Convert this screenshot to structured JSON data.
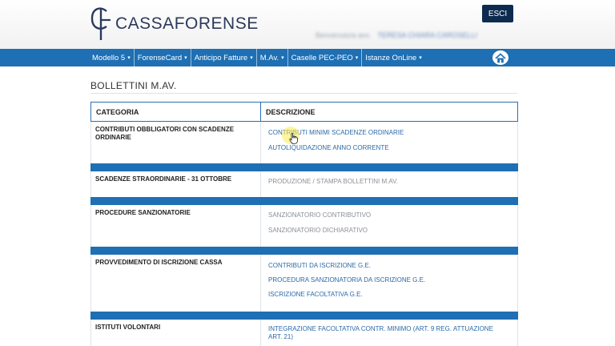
{
  "header": {
    "logo_text": "CASSAFORENSE",
    "exit_label": "ESCI",
    "user_label": "Benvenuto/a avv.",
    "user_name": "TERESA CHIARA CAROSELLI"
  },
  "nav": {
    "items": [
      {
        "label": "Modello 5"
      },
      {
        "label": "ForenseCard"
      },
      {
        "label": "Anticipo Fatture"
      },
      {
        "label": "M.Av."
      },
      {
        "label": "Caselle PEC-PEO"
      },
      {
        "label": "Istanze OnLine"
      }
    ],
    "caret": "▾"
  },
  "page": {
    "title": "BOLLETTINI M.AV."
  },
  "table": {
    "headers": {
      "category": "CATEGORIA",
      "description": "DESCRIZIONE"
    },
    "rows": [
      {
        "category": "CONTRIBUTI OBBLIGATORI CON SCADENZE ORDINARIE",
        "links": [
          {
            "label": "CONTRIBUTI MINIMI SCADENZE ORDINARIE",
            "enabled": true
          },
          {
            "label": "AUTOLIQUIDAZIONE ANNO CORRENTE",
            "enabled": true
          }
        ]
      },
      {
        "category": "SCADENZE STRAORDINARIE - 31 OTTOBRE",
        "links": [
          {
            "label": "PRODUZIONE / STAMPA BOLLETTINI M.AV.",
            "enabled": false
          }
        ]
      },
      {
        "category": "PROCEDURE SANZIONATORIE",
        "links": [
          {
            "label": "SANZIONATORIO CONTRIBUTIVO",
            "enabled": false
          },
          {
            "label": "SANZIONATORIO DICHIARATIVO",
            "enabled": false
          }
        ]
      },
      {
        "category": "PROVVEDIMENTO DI ISCRIZIONE CASSA",
        "links": [
          {
            "label": "CONTRIBUTI DA ISCRIZIONE G.E.",
            "enabled": true
          },
          {
            "label": "PROCEDURA SANZIONATORIA DA ISCRIZIONE G.E.",
            "enabled": true
          },
          {
            "label": "ISCRIZIONE FACOLTATIVA G.E.",
            "enabled": true
          }
        ]
      },
      {
        "category": "ISTITUTI VOLONTARI",
        "links": [
          {
            "label": "INTEGRAZIONE FACOLTATIVA CONTR. MINIMO (ART. 9 REG. ATTUAZIONE ART. 21)",
            "enabled": true
          }
        ]
      }
    ]
  },
  "colors": {
    "brand_blue": "#1e6fb3",
    "dark_navy": "#0d2b4f",
    "link_blue": "#2b6aa8",
    "disabled_grey": "#8a8f96"
  }
}
